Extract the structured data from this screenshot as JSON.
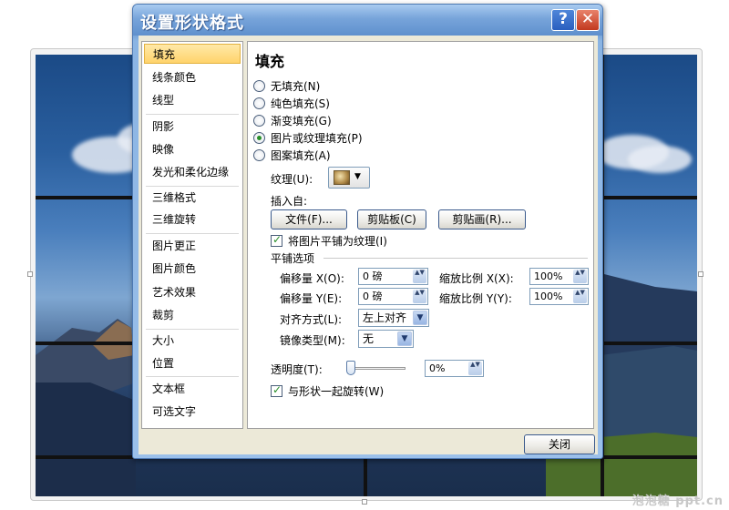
{
  "dialog": {
    "title": "设置形状格式",
    "help_glyph": "?",
    "close_glyph": "✕",
    "close_button": "关闭"
  },
  "nav": {
    "items": [
      "填充",
      "线条颜色",
      "线型",
      "阴影",
      "映像",
      "发光和柔化边缘",
      "三维格式",
      "三维旋转",
      "图片更正",
      "图片颜色",
      "艺术效果",
      "裁剪",
      "大小",
      "位置",
      "文本框",
      "可选文字"
    ],
    "selected": "填充"
  },
  "fill": {
    "heading": "填充",
    "options": [
      {
        "label": "无填充(N)",
        "selected": false
      },
      {
        "label": "纯色填充(S)",
        "selected": false
      },
      {
        "label": "渐变填充(G)",
        "selected": false
      },
      {
        "label": "图片或纹理填充(P)",
        "selected": true
      },
      {
        "label": "图案填充(A)",
        "selected": false
      }
    ],
    "texture_label": "纹理(U):",
    "insert_from_label": "插入自:",
    "file_button": "文件(F)...",
    "clipboard_button": "剪贴板(C)",
    "clipart_button": "剪贴画(R)...",
    "tile_checkbox": {
      "label": "将图片平铺为纹理(I)",
      "checked": true
    },
    "tiling_options_label": "平铺选项",
    "offset_x": {
      "label": "偏移量 X(O):",
      "value": "0 磅"
    },
    "offset_y": {
      "label": "偏移量 Y(E):",
      "value": "0 磅"
    },
    "scale_x": {
      "label": "缩放比例 X(X):",
      "value": "100%"
    },
    "scale_y": {
      "label": "缩放比例 Y(Y):",
      "value": "100%"
    },
    "alignment": {
      "label": "对齐方式(L):",
      "value": "左上对齐"
    },
    "mirror_type": {
      "label": "镜像类型(M):",
      "value": "无"
    },
    "transparency": {
      "label": "透明度(T):",
      "value": "0%",
      "level": 0
    },
    "rotate_checkbox": {
      "label": "与形状一起旋转(W)",
      "checked": true
    }
  },
  "background": {
    "watermark": "泡泡糖 ppt.cn"
  },
  "icons": {
    "spin": "▲▼",
    "dropdown": "▼"
  }
}
